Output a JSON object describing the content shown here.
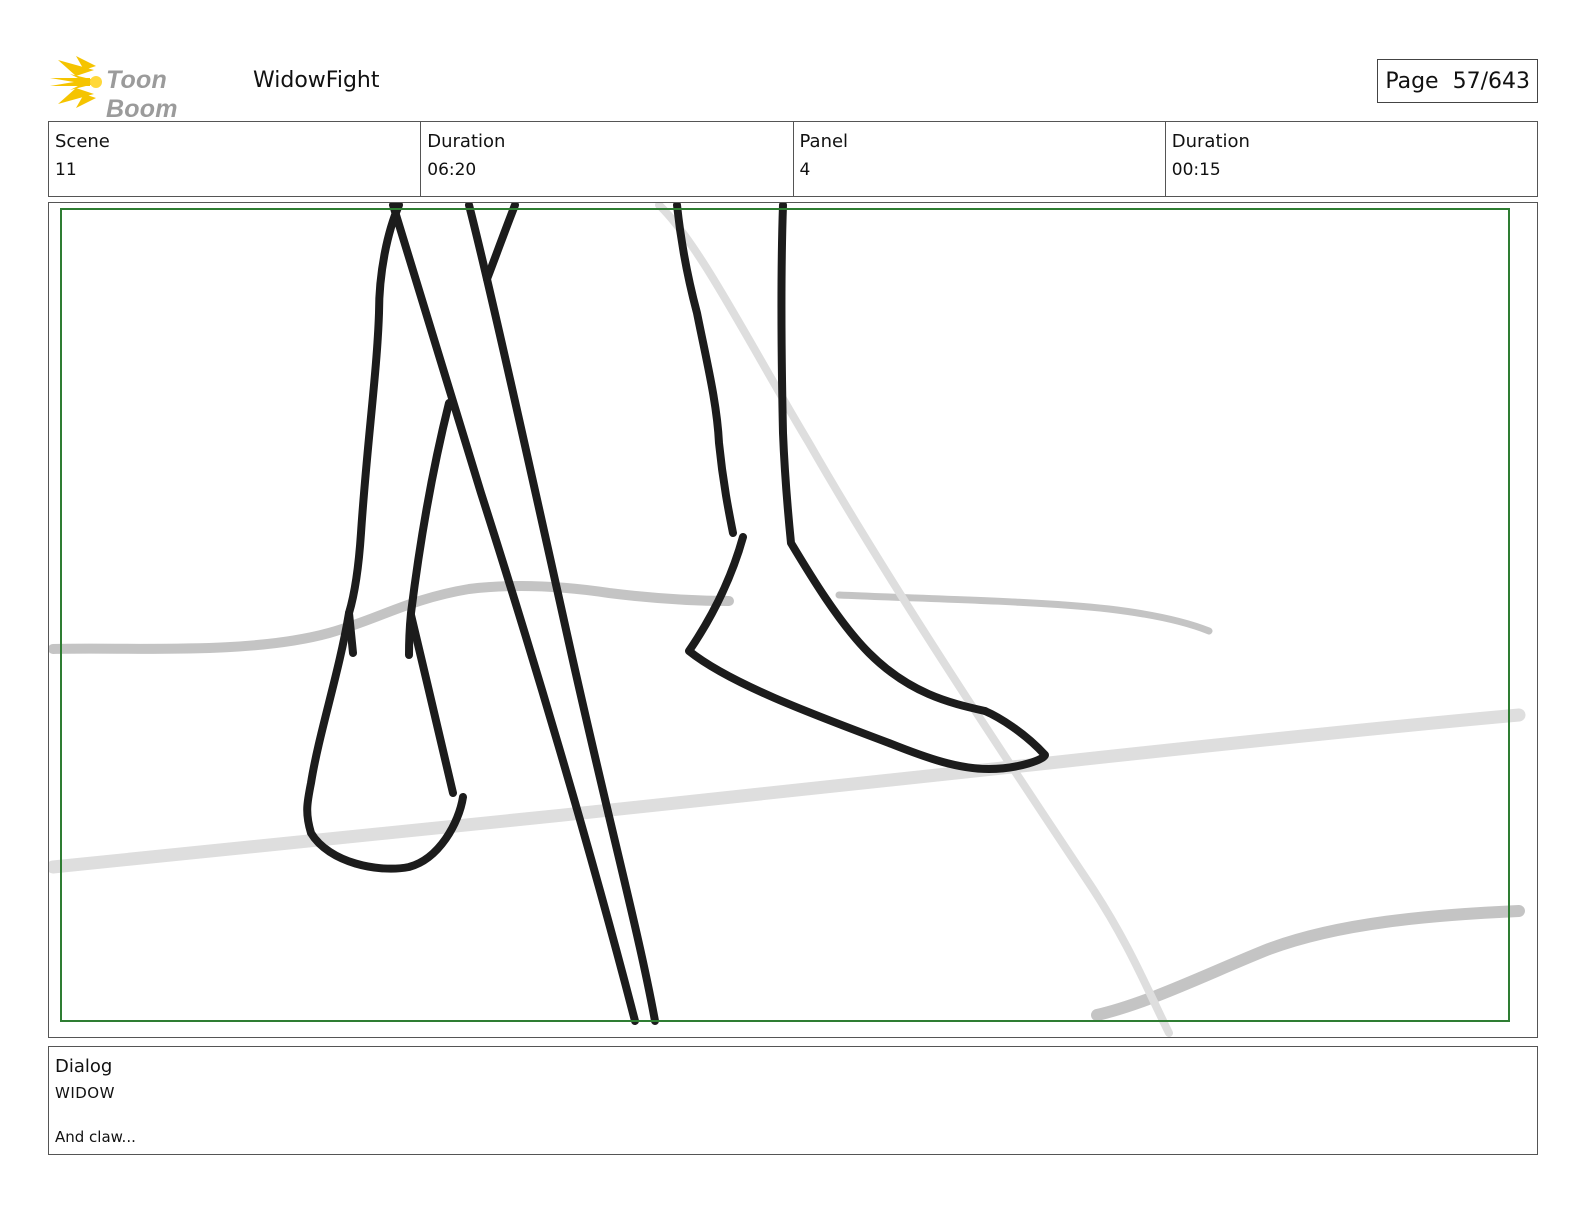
{
  "header": {
    "logo_text": "Toon Boom",
    "project_title": "WidowFight",
    "page_label": "Page",
    "page_number": "57/643"
  },
  "info": {
    "scene_label": "Scene",
    "scene_value": "11",
    "scene_duration_label": "Duration",
    "scene_duration_value": "06:20",
    "panel_label": "Panel",
    "panel_value": "4",
    "panel_duration_label": "Duration",
    "panel_duration_value": "00:15"
  },
  "dialog": {
    "label": "Dialog",
    "speaker": "WIDOW",
    "line": "And claw..."
  },
  "colors": {
    "safe_frame": "#2e7d32",
    "ink": "#1c1c1c",
    "background_sketch": "#c8c8c8",
    "logo_star": "#f5c400"
  }
}
